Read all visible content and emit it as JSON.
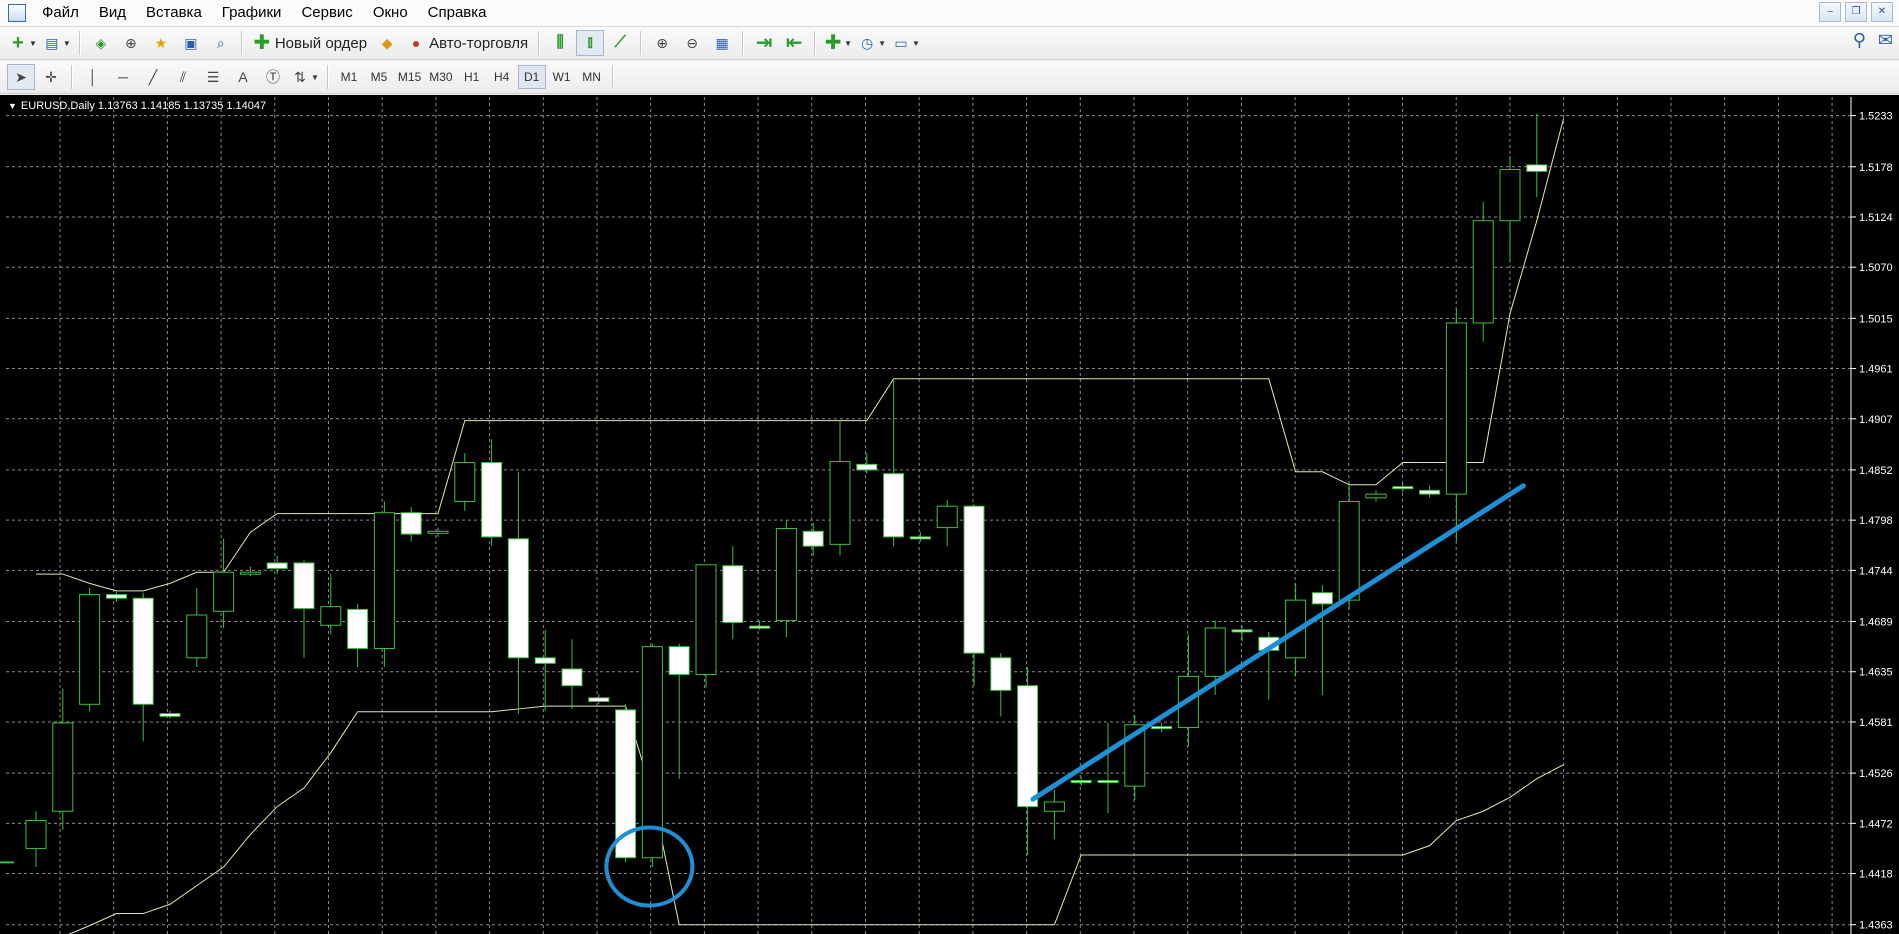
{
  "menu": {
    "items": [
      "Файл",
      "Вид",
      "Вставка",
      "Графики",
      "Сервис",
      "Окно",
      "Справка"
    ]
  },
  "toolbar": {
    "new_order_label": "Новый ордер",
    "auto_trading_label": "Авто-торговля"
  },
  "timeframes": [
    "M1",
    "M5",
    "M15",
    "M30",
    "H1",
    "H4",
    "D1",
    "W1",
    "MN"
  ],
  "active_timeframe": "D1",
  "chart": {
    "header": "EURUSD,Daily  1.13763 1.14185 1.13735 1.14047",
    "colors": {
      "background": "#000000",
      "grid": "#8a8a8a",
      "bull_candle": "#000000",
      "bear_candle": "#ffffff",
      "candle_outline": "#3cc03c",
      "channel_line": "#e8e4b6",
      "annotation": "#1e90d6"
    }
  },
  "chart_data": {
    "type": "candlestick",
    "symbol": "EURUSD",
    "timeframe": "Daily",
    "ylim": [
      1.4353,
      1.5253
    ],
    "y_ticks": [
      1.5233,
      1.5178,
      1.5124,
      1.507,
      1.5015,
      1.4961,
      1.4907,
      1.4852,
      1.4798,
      1.4744,
      1.4689,
      1.4635,
      1.4581,
      1.4526,
      1.4472,
      1.4418,
      1.4363
    ],
    "candles": [
      {
        "o": 1.4445,
        "h": 1.4485,
        "l": 1.4425,
        "c": 1.4475
      },
      {
        "o": 1.4485,
        "h": 1.4617,
        "l": 1.4465,
        "c": 1.458
      },
      {
        "o": 1.46,
        "h": 1.4725,
        "l": 1.4592,
        "c": 1.4718
      },
      {
        "o": 1.4718,
        "h": 1.4722,
        "l": 1.471,
        "c": 1.4714
      },
      {
        "o": 1.4714,
        "h": 1.472,
        "l": 1.456,
        "c": 1.46
      },
      {
        "o": 1.459,
        "h": 1.4593,
        "l": 1.4585,
        "c": 1.4587
      },
      {
        "o": 1.465,
        "h": 1.4725,
        "l": 1.464,
        "c": 1.4696
      },
      {
        "o": 1.47,
        "h": 1.4778,
        "l": 1.4682,
        "c": 1.4742
      },
      {
        "o": 1.4742,
        "h": 1.4748,
        "l": 1.4738,
        "c": 1.4742
      },
      {
        "o": 1.4752,
        "h": 1.476,
        "l": 1.474,
        "c": 1.4746
      },
      {
        "o": 1.4752,
        "h": 1.4755,
        "l": 1.465,
        "c": 1.4703
      },
      {
        "o": 1.4685,
        "h": 1.474,
        "l": 1.4675,
        "c": 1.4705
      },
      {
        "o": 1.4702,
        "h": 1.4708,
        "l": 1.464,
        "c": 1.466
      },
      {
        "o": 1.466,
        "h": 1.4818,
        "l": 1.464,
        "c": 1.4806
      },
      {
        "o": 1.4806,
        "h": 1.4812,
        "l": 1.4775,
        "c": 1.4783
      },
      {
        "o": 1.4785,
        "h": 1.479,
        "l": 1.478,
        "c": 1.4786
      },
      {
        "o": 1.4818,
        "h": 1.487,
        "l": 1.4808,
        "c": 1.486
      },
      {
        "o": 1.486,
        "h": 1.4885,
        "l": 1.477,
        "c": 1.478
      },
      {
        "o": 1.4778,
        "h": 1.485,
        "l": 1.459,
        "c": 1.465
      },
      {
        "o": 1.465,
        "h": 1.468,
        "l": 1.4593,
        "c": 1.4644
      },
      {
        "o": 1.4638,
        "h": 1.467,
        "l": 1.4595,
        "c": 1.462
      },
      {
        "o": 1.4607,
        "h": 1.4611,
        "l": 1.46,
        "c": 1.4603
      },
      {
        "o": 1.4594,
        "h": 1.46,
        "l": 1.443,
        "c": 1.4435
      },
      {
        "o": 1.4435,
        "h": 1.4665,
        "l": 1.4425,
        "c": 1.4662
      },
      {
        "o": 1.4662,
        "h": 1.4665,
        "l": 1.452,
        "c": 1.4632
      },
      {
        "o": 1.4632,
        "h": 1.4748,
        "l": 1.4618,
        "c": 1.475
      },
      {
        "o": 1.4749,
        "h": 1.477,
        "l": 1.467,
        "c": 1.4688
      },
      {
        "o": 1.4684,
        "h": 1.469,
        "l": 1.468,
        "c": 1.4682
      },
      {
        "o": 1.469,
        "h": 1.4798,
        "l": 1.4672,
        "c": 1.4789
      },
      {
        "o": 1.4786,
        "h": 1.4795,
        "l": 1.476,
        "c": 1.477
      },
      {
        "o": 1.4772,
        "h": 1.4905,
        "l": 1.476,
        "c": 1.4861
      },
      {
        "o": 1.4858,
        "h": 1.487,
        "l": 1.4848,
        "c": 1.4852
      },
      {
        "o": 1.4848,
        "h": 1.495,
        "l": 1.477,
        "c": 1.478
      },
      {
        "o": 1.478,
        "h": 1.4785,
        "l": 1.4775,
        "c": 1.4779
      },
      {
        "o": 1.479,
        "h": 1.482,
        "l": 1.477,
        "c": 1.4813
      },
      {
        "o": 1.4813,
        "h": 1.4815,
        "l": 1.462,
        "c": 1.4655
      },
      {
        "o": 1.465,
        "h": 1.4655,
        "l": 1.4587,
        "c": 1.4615
      },
      {
        "o": 1.462,
        "h": 1.464,
        "l": 1.4438,
        "c": 1.449
      },
      {
        "o": 1.4485,
        "h": 1.4508,
        "l": 1.4455,
        "c": 1.4495
      },
      {
        "o": 1.4518,
        "h": 1.4522,
        "l": 1.4512,
        "c": 1.4517
      },
      {
        "o": 1.4518,
        "h": 1.458,
        "l": 1.4483,
        "c": 1.4517
      },
      {
        "o": 1.4512,
        "h": 1.4588,
        "l": 1.4497,
        "c": 1.4578
      },
      {
        "o": 1.4576,
        "h": 1.458,
        "l": 1.457,
        "c": 1.4574
      },
      {
        "o": 1.4575,
        "h": 1.4675,
        "l": 1.4555,
        "c": 1.463
      },
      {
        "o": 1.463,
        "h": 1.469,
        "l": 1.461,
        "c": 1.4682
      },
      {
        "o": 1.468,
        "h": 1.4685,
        "l": 1.4668,
        "c": 1.4678
      },
      {
        "o": 1.4672,
        "h": 1.4678,
        "l": 1.4605,
        "c": 1.4658
      },
      {
        "o": 1.465,
        "h": 1.473,
        "l": 1.463,
        "c": 1.4712
      },
      {
        "o": 1.472,
        "h": 1.4728,
        "l": 1.461,
        "c": 1.4708
      },
      {
        "o": 1.4712,
        "h": 1.4838,
        "l": 1.4702,
        "c": 1.4818
      },
      {
        "o": 1.4822,
        "h": 1.483,
        "l": 1.4818,
        "c": 1.4826
      },
      {
        "o": 1.4834,
        "h": 1.4838,
        "l": 1.4828,
        "c": 1.4832
      },
      {
        "o": 1.483,
        "h": 1.4835,
        "l": 1.4822,
        "c": 1.4826
      },
      {
        "o": 1.4826,
        "h": 1.5025,
        "l": 1.4775,
        "c": 1.501
      },
      {
        "o": 1.501,
        "h": 1.514,
        "l": 1.499,
        "c": 1.512
      },
      {
        "o": 1.512,
        "h": 1.519,
        "l": 1.5075,
        "c": 1.5175
      },
      {
        "o": 1.518,
        "h": 1.5235,
        "l": 1.5145,
        "c": 1.5173
      }
    ],
    "upper_channel": [
      1.474,
      1.474,
      1.473,
      1.4722,
      1.4722,
      1.473,
      1.4742,
      1.4742,
      1.4785,
      1.4805,
      1.4805,
      1.4805,
      1.4805,
      1.4805,
      1.4805,
      1.4805,
      1.4905,
      1.4905,
      1.4905,
      1.4905,
      1.4905,
      1.4905,
      1.4905,
      1.4905,
      1.4905,
      1.4905,
      1.4905,
      1.4905,
      1.4905,
      1.4905,
      1.4905,
      1.4905,
      1.495,
      1.495,
      1.495,
      1.495,
      1.495,
      1.495,
      1.495,
      1.495,
      1.495,
      1.495,
      1.495,
      1.495,
      1.495,
      1.495,
      1.495,
      1.485,
      1.485,
      1.4836,
      1.4836,
      1.486,
      1.486,
      1.486,
      1.486,
      1.502,
      1.512,
      1.523
    ],
    "lower_channel": [
      1.434,
      1.435,
      1.4362,
      1.4375,
      1.4375,
      1.4385,
      1.4405,
      1.4425,
      1.446,
      1.449,
      1.451,
      1.4548,
      1.4592,
      1.4592,
      1.4592,
      1.4592,
      1.4592,
      1.4592,
      1.4595,
      1.4598,
      1.4598,
      1.4598,
      1.4598,
      1.4503,
      1.4363,
      1.4363,
      1.4363,
      1.4363,
      1.4363,
      1.4363,
      1.4363,
      1.4363,
      1.4363,
      1.4363,
      1.4363,
      1.4363,
      1.4363,
      1.4363,
      1.4363,
      1.4438,
      1.4438,
      1.4438,
      1.4438,
      1.4438,
      1.4438,
      1.4438,
      1.4438,
      1.4438,
      1.4438,
      1.4438,
      1.4438,
      1.4438,
      1.4448,
      1.4475,
      1.4485,
      1.45,
      1.452,
      1.4535
    ],
    "annotation_line": {
      "from": {
        "index": 37.2,
        "price": 1.4498
      },
      "to": {
        "index": 55.5,
        "price": 1.4835
      }
    },
    "annotation_circle": {
      "index": 23,
      "price": 1.4432
    }
  }
}
